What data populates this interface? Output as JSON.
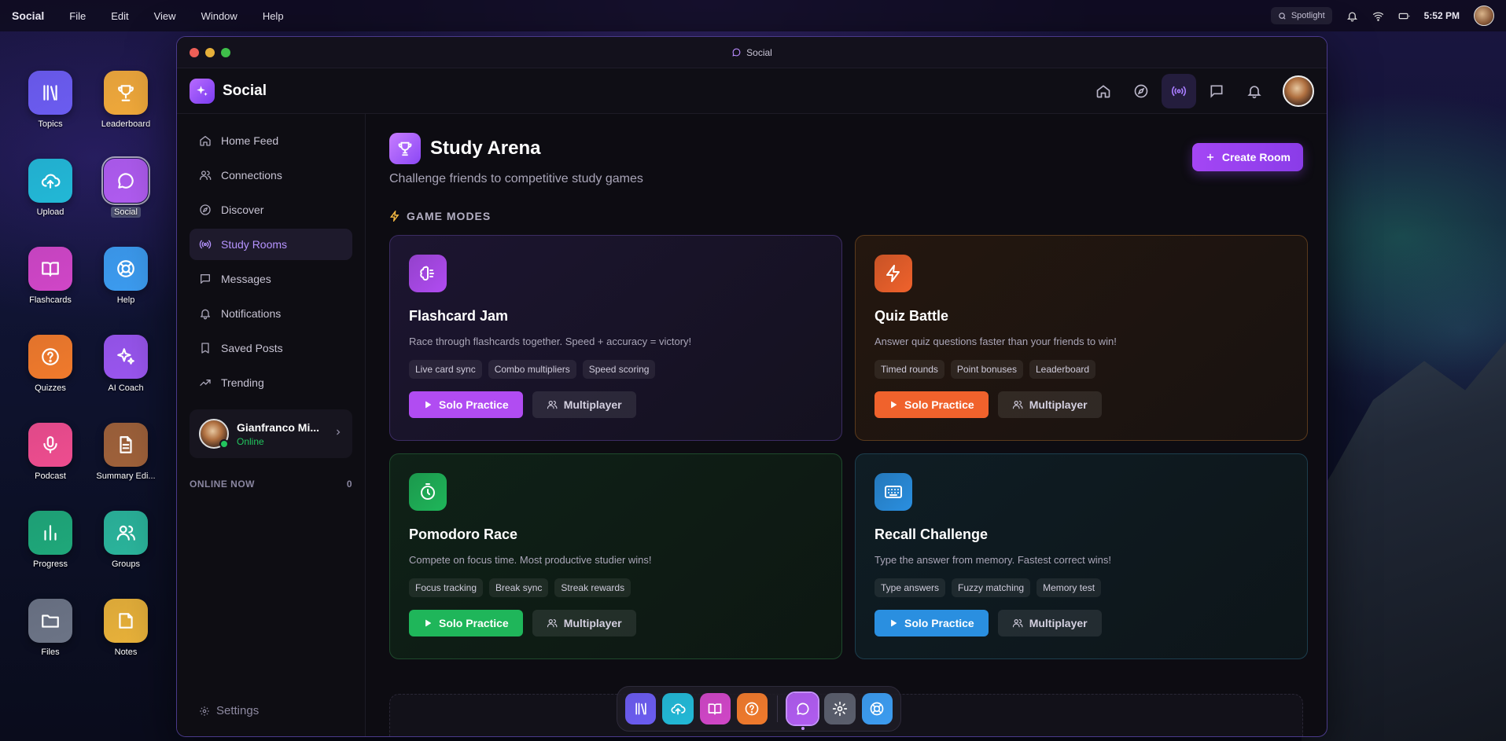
{
  "menubar": {
    "app_name": "Social",
    "menus": [
      "File",
      "Edit",
      "View",
      "Window",
      "Help"
    ],
    "spotlight_label": "Spotlight",
    "clock": "5:52 PM"
  },
  "desktop_icons": [
    {
      "label": "Topics",
      "icon": "library-icon",
      "color": "#6b5cf0"
    },
    {
      "label": "Leaderboard",
      "icon": "trophy-icon",
      "color": "#f0a93a"
    },
    {
      "label": "Upload",
      "icon": "upload-cloud-icon",
      "color": "#22b8d6"
    },
    {
      "label": "Social",
      "icon": "chat-bubble-icon",
      "color": "#b05cf0"
    },
    {
      "label": "Flashcards",
      "icon": "book-open-icon",
      "color": "#d046c7"
    },
    {
      "label": "Help",
      "icon": "lifebuoy-icon",
      "color": "#3c9cf0"
    },
    {
      "label": "Quizzes",
      "icon": "question-circle-icon",
      "color": "#f07a2c"
    },
    {
      "label": "AI Coach",
      "icon": "sparkles-icon",
      "color": "#9a56f0"
    },
    {
      "label": "Podcast",
      "icon": "microphone-icon",
      "color": "#ee4d8f"
    },
    {
      "label": "Summary Edi...",
      "icon": "document-icon",
      "color": "#a0623a"
    },
    {
      "label": "Progress",
      "icon": "bar-chart-icon",
      "color": "#1fa87a"
    },
    {
      "label": "Groups",
      "icon": "users-icon",
      "color": "#2bb59c"
    },
    {
      "label": "Files",
      "icon": "folder-icon",
      "color": "#6c7486"
    },
    {
      "label": "Notes",
      "icon": "note-icon",
      "color": "#e9b23a"
    }
  ],
  "window": {
    "title": "Social"
  },
  "header": {
    "brand": "Social"
  },
  "sidebar": {
    "items": [
      {
        "label": "Home Feed",
        "icon": "home-icon"
      },
      {
        "label": "Connections",
        "icon": "users-icon"
      },
      {
        "label": "Discover",
        "icon": "compass-icon"
      },
      {
        "label": "Study Rooms",
        "icon": "broadcast-icon"
      },
      {
        "label": "Messages",
        "icon": "message-square-icon"
      },
      {
        "label": "Notifications",
        "icon": "bell-icon"
      },
      {
        "label": "Saved Posts",
        "icon": "bookmark-icon"
      },
      {
        "label": "Trending",
        "icon": "trending-up-icon"
      }
    ],
    "active_index": 3,
    "user": {
      "name": "Gianfranco Mi...",
      "status": "Online"
    },
    "online_now_label": "ONLINE NOW",
    "online_now_count": "0",
    "settings_label": "Settings"
  },
  "main": {
    "title": "Study Arena",
    "subtitle": "Challenge friends to competitive study games",
    "create_button": "Create Room",
    "section_label": "GAME MODES",
    "cards": [
      {
        "title": "Flashcard Jam",
        "description": "Race through flashcards together. Speed + accuracy = victory!",
        "tags": [
          "Live card sync",
          "Combo multipliers",
          "Speed scoring"
        ],
        "solo": "Solo Practice",
        "multi": "Multiplayer",
        "theme": "purple",
        "accent": "#b14cf2",
        "icon": "brain-icon"
      },
      {
        "title": "Quiz Battle",
        "description": "Answer quiz questions faster than your friends to win!",
        "tags": [
          "Timed rounds",
          "Point bonuses",
          "Leaderboard"
        ],
        "solo": "Solo Practice",
        "multi": "Multiplayer",
        "theme": "orange",
        "accent": "#f0622c",
        "icon": "lightning-icon"
      },
      {
        "title": "Pomodoro Race",
        "description": "Compete on focus time. Most productive studier wins!",
        "tags": [
          "Focus tracking",
          "Break sync",
          "Streak rewards"
        ],
        "solo": "Solo Practice",
        "multi": "Multiplayer",
        "theme": "green",
        "accent": "#1fb65a",
        "icon": "stopwatch-icon"
      },
      {
        "title": "Recall Challenge",
        "description": "Type the answer from memory. Fastest correct wins!",
        "tags": [
          "Type answers",
          "Fuzzy matching",
          "Memory test"
        ],
        "solo": "Solo Practice",
        "multi": "Multiplayer",
        "theme": "blue",
        "accent": "#2a8fe0",
        "icon": "keyboard-icon"
      }
    ]
  },
  "dock": {
    "items": [
      "library-icon",
      "upload-cloud-icon",
      "book-open-icon",
      "question-circle-icon",
      "chat-bubble-icon",
      "gear-icon",
      "lifebuoy-icon"
    ]
  }
}
